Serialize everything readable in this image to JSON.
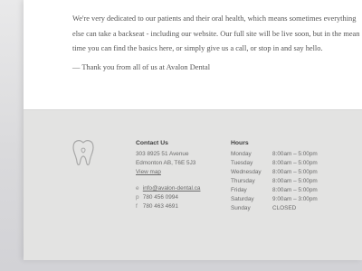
{
  "content": {
    "paragraph_lines": [
      "We're very dedicated to our patients and their oral health, which means sometimes everything",
      "else can take a backseat - including our website.  Our full site will be live soon, but in the mean",
      "time you can find the basics here, or simply give us a call, or stop in and say hello."
    ],
    "signoff": "— Thank you from all of us at Avalon Dental"
  },
  "footer": {
    "logo_icon": "tooth-icon",
    "contact": {
      "heading": "Contact Us",
      "address_line1": "303 8925 51 Avenue",
      "address_line2": "Edmonton AB, T6E 5J3",
      "map_link": "View map",
      "email_label": "e",
      "email": "info@avalon-dental.ca",
      "phone_label": "p",
      "phone": "780 456 0994",
      "fax_label": "f",
      "fax": "780 463 4691"
    },
    "hours": {
      "heading": "Hours",
      "rows": [
        {
          "day": "Monday",
          "time": "8:00am – 5:00pm"
        },
        {
          "day": "Tuesday",
          "time": "8:00am – 5:00pm"
        },
        {
          "day": "Wednesday",
          "time": "8:00am – 5:00pm"
        },
        {
          "day": "Thursday",
          "time": "8:00am – 5:00pm"
        },
        {
          "day": "Friday",
          "time": "8:00am – 5:00pm"
        },
        {
          "day": "Saturday",
          "time": "9:00am – 3:00pm"
        },
        {
          "day": "Sunday",
          "time": "CLOSED"
        }
      ]
    }
  }
}
